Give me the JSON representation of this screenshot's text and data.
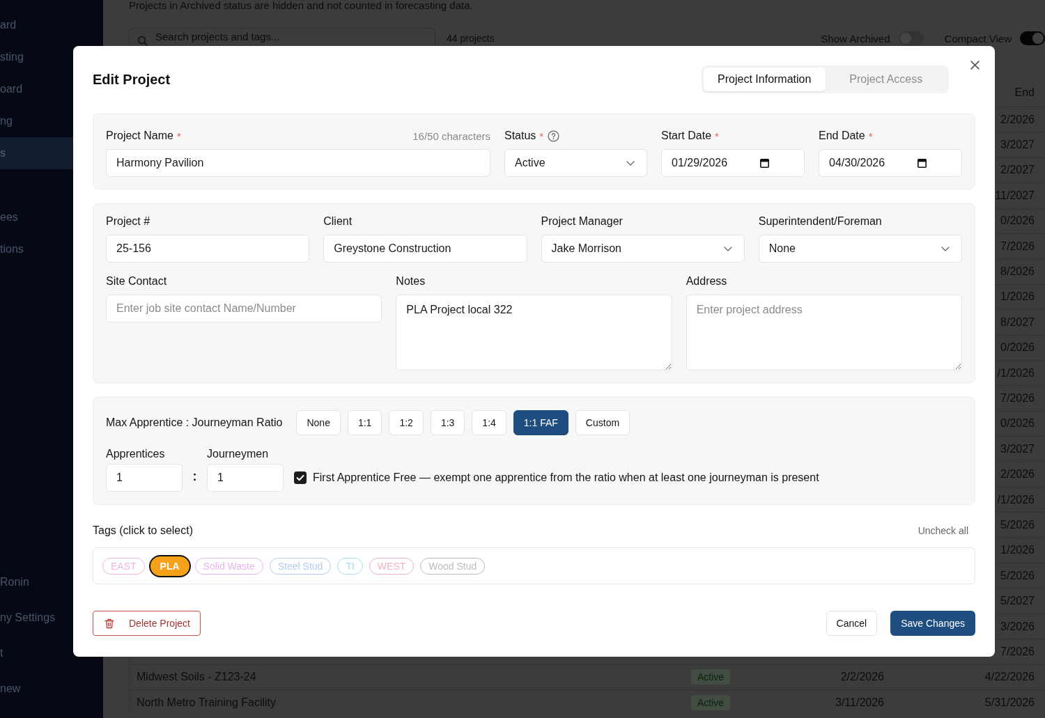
{
  "sidebar": {
    "groups": [
      {
        "items": [
          {
            "label": "ard",
            "selected": false
          },
          {
            "label": "sting",
            "selected": false
          },
          {
            "label": "oard",
            "selected": false
          },
          {
            "label": "ng",
            "selected": false
          },
          {
            "label": "s",
            "selected": true
          }
        ]
      },
      {
        "items": [
          {
            "label": "ees",
            "selected": false
          },
          {
            "label": "tions",
            "selected": false
          }
        ]
      }
    ],
    "footer_items": [
      {
        "label": "Ronin",
        "selected": false
      },
      {
        "label": "ny Settings",
        "selected": false
      },
      {
        "label": "t",
        "selected": false
      },
      {
        "label": "new",
        "selected": false
      }
    ]
  },
  "page": {
    "notice": "Projects in Archived status are hidden and not counted in forecasting data.",
    "search": {
      "placeholder": "Search projects and tags..."
    },
    "count": "44 projects",
    "toggles": [
      {
        "label": "Show Archived",
        "on": false
      },
      {
        "label": "Compact View",
        "on": true
      }
    ]
  },
  "table": {
    "end_column": "End",
    "rows": [
      {
        "end": "2/2026"
      },
      {
        "end": "3/2027"
      },
      {
        "end": "2/2027"
      },
      {
        "end": "11/2027"
      },
      {
        "end": "0/2026"
      },
      {
        "end": "7/2026"
      },
      {
        "end": "8/2026"
      },
      {
        "end": "1/2026"
      },
      {
        "end": "8/2027"
      },
      {
        "end": "0/2026"
      },
      {
        "end": "/1/2026"
      },
      {
        "end": "7/2026"
      },
      {
        "end": "0/2026"
      },
      {
        "end": "3/2027"
      },
      {
        "end": "2/2026"
      },
      {
        "end": "/1/2026"
      },
      {
        "end": "5/2026"
      },
      {
        "end": "1/2026"
      },
      {
        "end": "5/2026"
      },
      {
        "end": "5/2027"
      },
      {
        "end": "3/2026"
      },
      {
        "end": "7/2026"
      },
      {
        "name": "Midwest Soils - Z123-24",
        "status": "Active",
        "start": "2/2/2026",
        "end": "4/22/2026"
      },
      {
        "name": "North Metro Training Facility",
        "status": "Active",
        "start": "3/11/2026",
        "end": "5/31/2026"
      }
    ]
  },
  "dialog": {
    "title": "Edit Project",
    "tabs": [
      {
        "label": "Project Information",
        "selected": true
      },
      {
        "label": "Project Access",
        "selected": false
      }
    ],
    "sections": [
      {
        "rows": [
          [
            {
              "kind": "text",
              "label": "Project Name",
              "required_mark": "*",
              "counter": "16/50 characters",
              "value": "Harmony Pavilion"
            },
            {
              "kind": "select",
              "label": "Status",
              "required_mark": "*",
              "help": true,
              "value": "Active"
            },
            {
              "kind": "date",
              "label": "Start Date",
              "required_mark": "*",
              "value": "01/29/2026"
            },
            {
              "kind": "date",
              "label": "End Date",
              "required_mark": "*",
              "value": "04/30/2026"
            }
          ]
        ]
      },
      {
        "rows": [
          [
            {
              "kind": "text",
              "label": "Project #",
              "value": "25-156"
            },
            {
              "kind": "text",
              "label": "Client",
              "value": "Greystone Construction"
            },
            {
              "kind": "select",
              "label": "Project Manager",
              "value": "Jake Morrison"
            },
            {
              "kind": "select",
              "label": "Superintendent/Foreman",
              "value": "None"
            }
          ],
          [
            {
              "kind": "text",
              "label": "Site Contact",
              "placeholder": "Enter job site contact Name/Number"
            },
            {
              "kind": "textarea",
              "label": "Notes",
              "value": "PLA Project local 322"
            },
            {
              "kind": "textarea",
              "label": "Address",
              "placeholder": "Enter project address"
            }
          ]
        ]
      }
    ],
    "ratio": {
      "label": "Max Apprentice : Journeyman Ratio",
      "options": [
        {
          "label": "None",
          "selected": false
        },
        {
          "label": "1:1",
          "selected": false
        },
        {
          "label": "1:2",
          "selected": false
        },
        {
          "label": "1:3",
          "selected": false
        },
        {
          "label": "1:4",
          "selected": false
        },
        {
          "label": "1:1 FAF",
          "selected": true
        },
        {
          "label": "Custom",
          "selected": false
        }
      ],
      "apprentices": {
        "label": "Apprentices",
        "value": "1"
      },
      "separator": ":",
      "journeymen": {
        "label": "Journeymen",
        "value": "1"
      },
      "first_apprentice_free": {
        "checked": true,
        "label": "First Apprentice Free — exempt one apprentice from the ratio when at least one journeyman is present"
      }
    },
    "tags": {
      "label": "Tags (click to select)",
      "uncheck_all": "Uncheck all",
      "items": [
        {
          "label": "EAST",
          "color": "#efb5e3",
          "selected": false
        },
        {
          "label": "PLA",
          "color": "#f5a11a",
          "selected": true
        },
        {
          "label": "Solid Waste",
          "color": "#e6b4ee",
          "selected": false
        },
        {
          "label": "Steel Stud",
          "color": "#b3cbef",
          "selected": false
        },
        {
          "label": "TI",
          "color": "#a8dcea",
          "selected": false
        },
        {
          "label": "WEST",
          "color": "#f2b2c0",
          "selected": false
        },
        {
          "label": "Wood Stud",
          "color": "#bcbcbc",
          "selected": false
        }
      ]
    },
    "actions": {
      "delete": "Delete Project",
      "cancel": "Cancel",
      "save": "Save Changes"
    }
  }
}
